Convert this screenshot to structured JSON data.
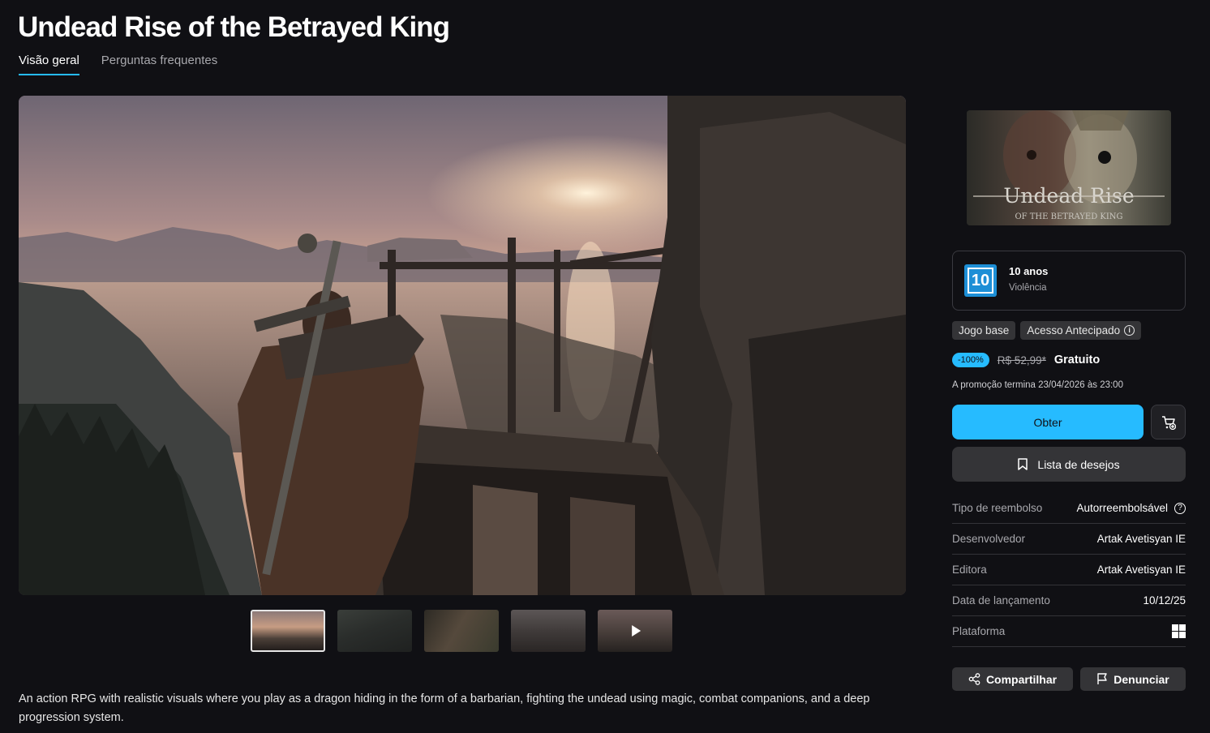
{
  "page": {
    "title": "Undead Rise of the Betrayed King",
    "tabs": [
      {
        "label": "Visão geral"
      },
      {
        "label": "Perguntas frequentes"
      }
    ]
  },
  "media": {
    "thumbnail_count": 5,
    "active_index": 0,
    "video_thumbnail_index": 4
  },
  "description": "An action RPG with realistic visuals where you play as a dragon hiding in the form of a barbarian, fighting the undead using magic, combat companions, and a deep progression system.",
  "sidebar": {
    "cover_logo_line1": "Undead Rise",
    "cover_logo_line2": "OF THE BETRAYED KING",
    "rating": {
      "badge": "10",
      "age": "10 anos",
      "descriptor": "Violência",
      "color": "#1d8fd6"
    },
    "tags": [
      "Jogo base",
      "Acesso Antecipado"
    ],
    "price": {
      "discount": "-100%",
      "original": "R$ 52,99*",
      "final": "Gratuito"
    },
    "promo_end": "A promoção termina 23/04/2026 às 23:00",
    "get_button": "Obter",
    "wishlist_button": "Lista de desejos",
    "details": [
      {
        "label": "Tipo de reembolso",
        "value": "Autorreembolsável",
        "icon": "question-circle-icon"
      },
      {
        "label": "Desenvolvedor",
        "value": "Artak Avetisyan IE"
      },
      {
        "label": "Editora",
        "value": "Artak Avetisyan IE"
      },
      {
        "label": "Data de lançamento",
        "value": "10/12/25"
      },
      {
        "label": "Plataforma",
        "value": "",
        "icon": "windows-icon"
      }
    ],
    "share_button": "Compartilhar",
    "report_button": "Denunciar"
  },
  "colors": {
    "accent": "#26bbff",
    "background": "#101014",
    "surface": "#343437"
  }
}
